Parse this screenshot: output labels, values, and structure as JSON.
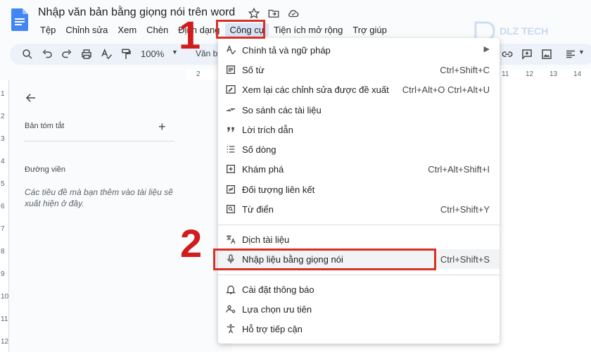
{
  "title": "Nhập văn bản bằng giọng nói trên word",
  "menubar": [
    "Tệp",
    "Chỉnh sửa",
    "Xem",
    "Chèn",
    "Định dạng",
    "Công cụ",
    "Tiện ích mở rộng",
    "Trợ giúp"
  ],
  "toolbar": {
    "zoom": "100%",
    "style_text": "Văn b"
  },
  "logo_text": "DLZ TECH",
  "step_labels": {
    "one": "1",
    "two": "2"
  },
  "side_panel": {
    "summary_label": "Bản tóm tắt",
    "plus": "+",
    "outline_label": "Đường viền",
    "outline_hint": "Các tiêu đề mà bạn thêm vào tài liệu sẽ xuất hiện ở đây."
  },
  "ruler": {
    "top": [
      "2",
      "11",
      "12",
      "13",
      "14"
    ],
    "left": [
      "1",
      "2",
      "3",
      "4",
      "5",
      "6",
      "7",
      "8",
      "9",
      "10",
      "11",
      "12"
    ]
  },
  "menu": {
    "items": [
      {
        "label": "Chính tả và ngữ pháp",
        "shortcut": "",
        "submenu": true,
        "icon": "spellcheck-icon"
      },
      {
        "label": "Số từ",
        "shortcut": "Ctrl+Shift+C",
        "icon": "word-count-icon"
      },
      {
        "label": "Xem lại các chỉnh sửa được đề xuất",
        "shortcut": "Ctrl+Alt+O Ctrl+Alt+U",
        "icon": "review-edits-icon"
      },
      {
        "label": "So sánh các tài liệu",
        "shortcut": "",
        "icon": "compare-icon"
      },
      {
        "label": "Lời trích dẫn",
        "shortcut": "",
        "icon": "quote-icon"
      },
      {
        "label": "Số dòng",
        "shortcut": "",
        "icon": "line-numbers-icon"
      },
      {
        "label": "Khám phá",
        "shortcut": "Ctrl+Alt+Shift+I",
        "icon": "explore-icon"
      },
      {
        "label": "Đối tượng liên kết",
        "shortcut": "",
        "icon": "linked-objects-icon"
      },
      {
        "label": "Từ điển",
        "shortcut": "Ctrl+Shift+Y",
        "icon": "dictionary-icon"
      },
      {
        "label": "Dịch tài liệu",
        "shortcut": "",
        "icon": "translate-icon"
      },
      {
        "label": "Nhập liệu bằng giọng nói",
        "shortcut": "Ctrl+Shift+S",
        "icon": "microphone-icon"
      },
      {
        "label": "Cài đặt thông báo",
        "shortcut": "",
        "icon": "bell-icon"
      },
      {
        "label": "Lựa chọn ưu tiên",
        "shortcut": "",
        "icon": "preferences-icon"
      },
      {
        "label": "Hỗ trợ tiếp cận",
        "shortcut": "",
        "icon": "accessibility-icon"
      }
    ]
  },
  "colors": {
    "accent": "#d93025",
    "menu_active": "#dbe4f5",
    "toolbar_bg": "#edf2fa",
    "doc_blue": "#4285f4"
  }
}
